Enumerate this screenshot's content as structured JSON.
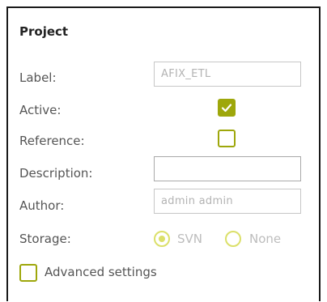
{
  "panel": {
    "title": "Project"
  },
  "form": {
    "label": {
      "label": "Label:",
      "value": "AFIX_ETL"
    },
    "active": {
      "label": "Active:",
      "checked": true
    },
    "reference": {
      "label": "Reference:",
      "checked": false
    },
    "description": {
      "label": "Description:",
      "value": ""
    },
    "author": {
      "label": "Author:",
      "value": "admin admin"
    },
    "storage": {
      "label": "Storage:",
      "options": [
        "SVN",
        "None"
      ],
      "selected": "SVN"
    },
    "advanced": {
      "label": "Advanced settings",
      "checked": false
    }
  },
  "colors": {
    "accent": "#9ea70b",
    "accent_light": "#dbe06a"
  },
  "icons": {
    "check": "checkmark-icon"
  }
}
